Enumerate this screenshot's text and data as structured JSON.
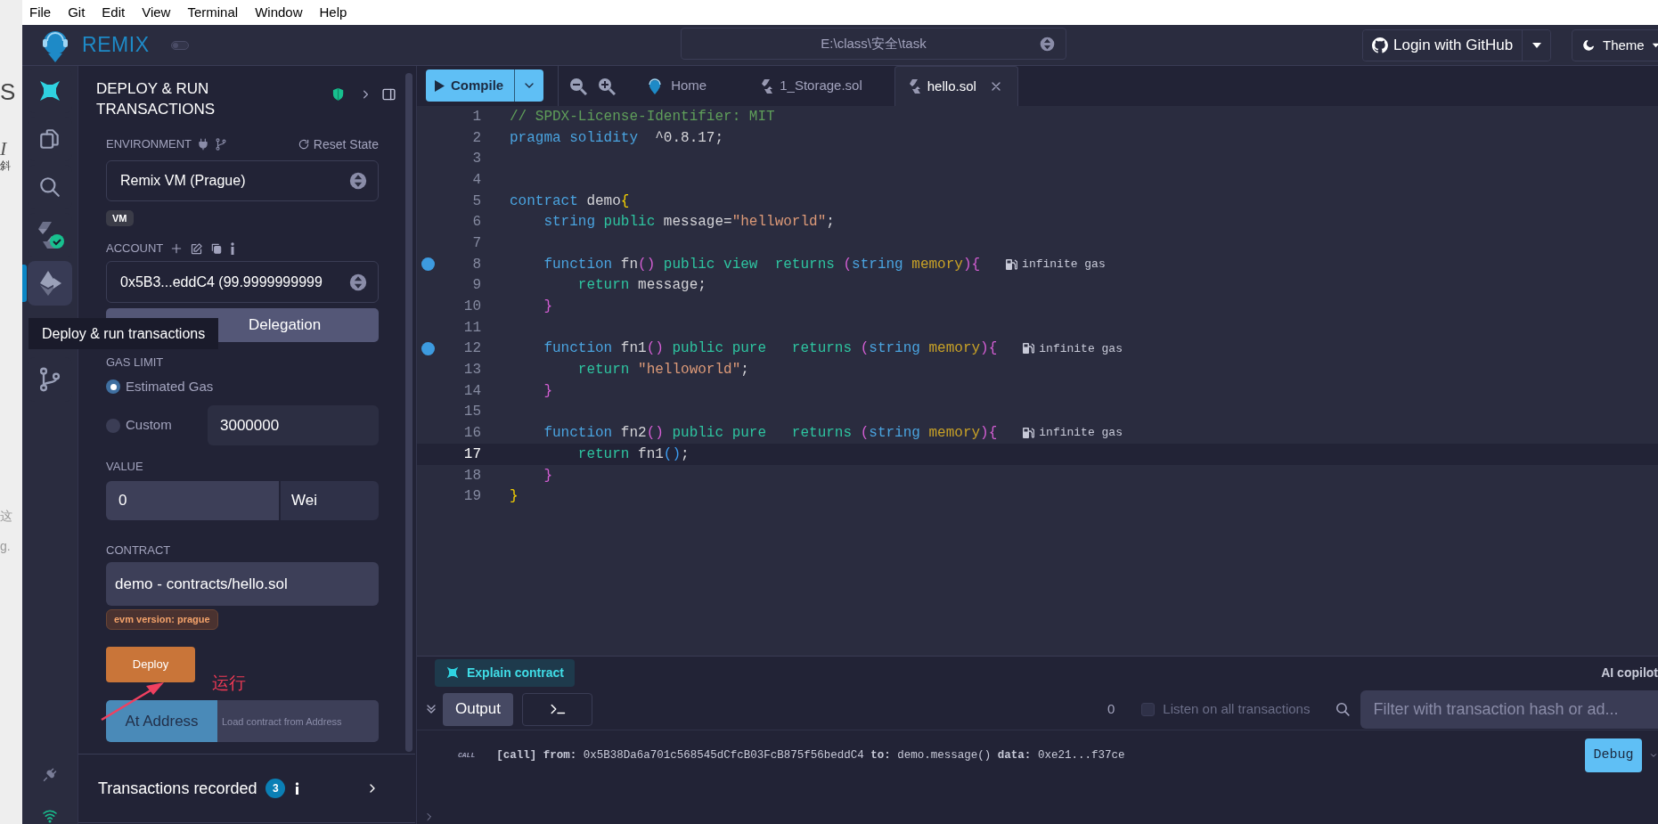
{
  "background_window": {
    "fragments": [
      "S",
      "I",
      "斜",
      "这",
      "g."
    ]
  },
  "menu_bar": [
    "File",
    "Git",
    "Edit",
    "View",
    "Terminal",
    "Window",
    "Help"
  ],
  "header": {
    "brand": "REMIX",
    "toggle": {
      "on": false
    },
    "workspace_path": "E:\\class\\安全\\task",
    "login_button": "Login with GitHub",
    "theme_button": "Theme"
  },
  "icon_bar": {
    "items": [
      {
        "kind": "ai",
        "selected": false
      },
      {
        "kind": "files",
        "selected": false
      },
      {
        "kind": "search",
        "selected": false
      },
      {
        "kind": "compiler",
        "selected": false
      },
      {
        "kind": "deploy",
        "selected": true
      },
      {
        "kind": "git",
        "selected": false
      }
    ],
    "bottom_items": [
      {
        "kind": "plugin"
      },
      {
        "kind": "network"
      }
    ]
  },
  "tooltip": "Deploy & run transactions",
  "side_panel": {
    "title": "DEPLOY & RUN TRANSACTIONS",
    "environment": {
      "label": "ENVIRONMENT",
      "reset": "Reset State",
      "value": "Remix VM (Prague)",
      "badge": "VM"
    },
    "account": {
      "label": "ACCOUNT",
      "value": "0x5B3...eddC4 (99.9999999999"
    },
    "delegation_button": "Delegation",
    "gas_limit": {
      "label": "GAS LIMIT",
      "options": [
        {
          "label": "Estimated Gas",
          "selected": true
        },
        {
          "label": "Custom",
          "selected": false
        }
      ],
      "value": "3000000"
    },
    "value": {
      "label": "VALUE",
      "amount": "0",
      "unit": "Wei"
    },
    "contract": {
      "label": "CONTRACT",
      "value": "demo - contracts/hello.sol",
      "evm_badge": "evm version: prague"
    },
    "deploy_button": "Deploy",
    "at_address_button": "At Address",
    "address_placeholder": "Load contract from Address",
    "transactions": {
      "label": "Transactions recorded",
      "count": "3"
    }
  },
  "annotation": {
    "text": "运行"
  },
  "editor": {
    "compile_button": "Compile",
    "tabs": [
      {
        "label": "Home",
        "kind": "home",
        "selected": false
      },
      {
        "label": "1_Storage.sol",
        "kind": "file",
        "selected": false
      },
      {
        "label": "hello.sol",
        "kind": "file",
        "selected": true
      }
    ],
    "lines": [
      {
        "number": "1",
        "breakpoint": false,
        "current": false,
        "tokens": [
          {
            "kind": "comment",
            "text": "// SPDX-License-Identifier: MIT"
          }
        ]
      },
      {
        "number": "2",
        "breakpoint": false,
        "current": false,
        "tokens": [
          {
            "kind": "kw",
            "text": "pragma solidity"
          },
          {
            "kind": "plain",
            "text": "  ^0.8.17;"
          }
        ]
      },
      {
        "number": "3",
        "breakpoint": false,
        "current": false
      },
      {
        "number": "4",
        "breakpoint": false,
        "current": false
      },
      {
        "number": "5",
        "breakpoint": false,
        "current": false,
        "tokens": [
          {
            "kind": "kw",
            "text": "contract"
          },
          {
            "kind": "plain",
            "text": " demo"
          },
          {
            "kind": "br1",
            "text": "{"
          }
        ]
      },
      {
        "number": "6",
        "breakpoint": false,
        "current": false,
        "tokens": [
          {
            "kind": "kw",
            "text": "    string"
          },
          {
            "kind": "mod",
            "text": " public"
          },
          {
            "kind": "plain",
            "text": " message="
          },
          {
            "kind": "str",
            "text": "\"hellworld\""
          },
          {
            "kind": "plain",
            "text": ";"
          }
        ]
      },
      {
        "number": "7",
        "breakpoint": false,
        "current": false
      },
      {
        "number": "8",
        "breakpoint": true,
        "current": false,
        "gas": "infinite gas",
        "tokens": [
          {
            "kind": "kw",
            "text": "    function"
          },
          {
            "kind": "plain",
            "text": " fn"
          },
          {
            "kind": "br2",
            "text": "()"
          },
          {
            "kind": "mod",
            "text": " public view  returns "
          },
          {
            "kind": "br2",
            "text": "("
          },
          {
            "kind": "kw",
            "text": "string"
          },
          {
            "kind": "sto",
            "text": " memory"
          },
          {
            "kind": "br2",
            "text": "){"
          }
        ]
      },
      {
        "number": "9",
        "breakpoint": false,
        "current": false,
        "tokens": [
          {
            "kind": "mod",
            "text": "        return"
          },
          {
            "kind": "plain",
            "text": " message;"
          }
        ]
      },
      {
        "number": "10",
        "breakpoint": false,
        "current": false,
        "tokens": [
          {
            "kind": "br2",
            "text": "    }"
          }
        ]
      },
      {
        "number": "11",
        "breakpoint": false,
        "current": false
      },
      {
        "number": "12",
        "breakpoint": true,
        "current": false,
        "gas": "infinite gas",
        "tokens": [
          {
            "kind": "kw",
            "text": "    function"
          },
          {
            "kind": "plain",
            "text": " fn1"
          },
          {
            "kind": "br2",
            "text": "()"
          },
          {
            "kind": "mod",
            "text": " public pure   returns "
          },
          {
            "kind": "br2",
            "text": "("
          },
          {
            "kind": "kw",
            "text": "string"
          },
          {
            "kind": "sto",
            "text": " memory"
          },
          {
            "kind": "br2",
            "text": "){"
          }
        ]
      },
      {
        "number": "13",
        "breakpoint": false,
        "current": false,
        "tokens": [
          {
            "kind": "mod",
            "text": "        return"
          },
          {
            "kind": "str",
            "text": " \"helloworld\""
          },
          {
            "kind": "plain",
            "text": ";"
          }
        ]
      },
      {
        "number": "14",
        "breakpoint": false,
        "current": false,
        "tokens": [
          {
            "kind": "br2",
            "text": "    }"
          }
        ]
      },
      {
        "number": "15",
        "breakpoint": false,
        "current": false
      },
      {
        "number": "16",
        "breakpoint": false,
        "current": false,
        "gas": "infinite gas",
        "tokens": [
          {
            "kind": "kw",
            "text": "    function"
          },
          {
            "kind": "plain",
            "text": " fn2"
          },
          {
            "kind": "br2",
            "text": "()"
          },
          {
            "kind": "mod",
            "text": " public pure   returns "
          },
          {
            "kind": "br2",
            "text": "("
          },
          {
            "kind": "kw",
            "text": "string"
          },
          {
            "kind": "sto",
            "text": " memory"
          },
          {
            "kind": "br2",
            "text": "){"
          }
        ]
      },
      {
        "number": "17",
        "breakpoint": false,
        "current": true,
        "tokens": [
          {
            "kind": "mod",
            "text": "        return"
          },
          {
            "kind": "plain",
            "text": " fn1"
          },
          {
            "kind": "br3",
            "text": "()"
          },
          {
            "kind": "plain",
            "text": ";"
          }
        ]
      },
      {
        "number": "18",
        "breakpoint": false,
        "current": false,
        "tokens": [
          {
            "kind": "br2",
            "text": "    }"
          }
        ]
      },
      {
        "number": "19",
        "breakpoint": false,
        "current": false,
        "tokens": [
          {
            "kind": "br1",
            "text": "}"
          }
        ]
      }
    ]
  },
  "terminal": {
    "explain_button": "Explain contract",
    "copilot": "AI copilot",
    "output_tab": "Output",
    "count": "0",
    "listen": {
      "label": "Listen on all transactions",
      "checked": false
    },
    "filter_placeholder": "Filter with transaction hash or ad...",
    "log": {
      "tag": "CALL",
      "text": "**[call]** **from:** 0x5B38Da6a701c568545dCfcB03FcB875f56beddC4 **to:** demo.message() **data:** 0xe21...f37ce",
      "debug_button": "Debug"
    }
  }
}
